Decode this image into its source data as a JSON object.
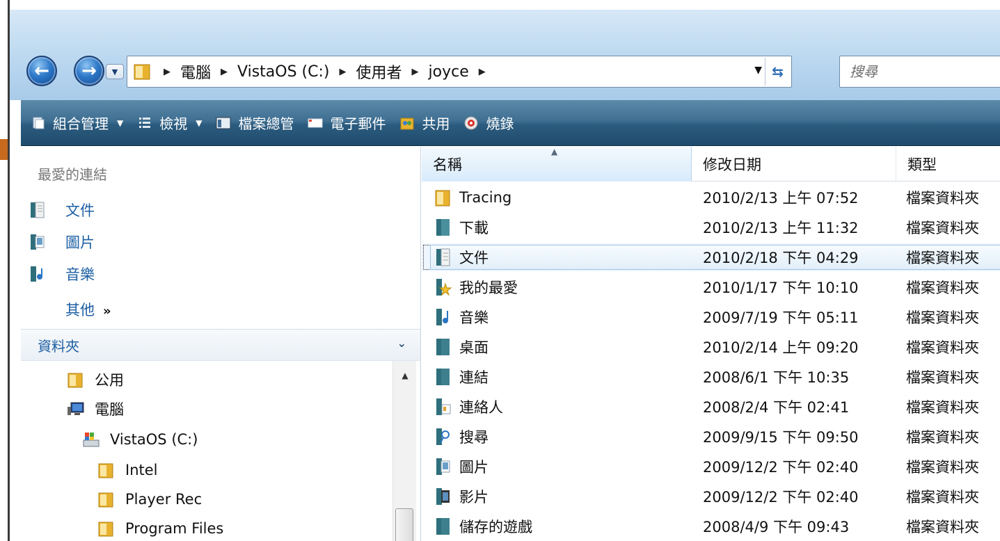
{
  "address": {
    "crumbs": [
      "電腦",
      "VistaOS (C:)",
      "使用者",
      "joyce"
    ],
    "search_placeholder": "搜尋"
  },
  "toolbar": {
    "organize": "組合管理",
    "views": "檢視",
    "explore": "檔案總管",
    "email": "電子郵件",
    "share": "共用",
    "burn": "燒錄"
  },
  "navpane": {
    "favorites_title": "最愛的連結",
    "favorites": [
      {
        "label": "文件",
        "icon": "documents-icon"
      },
      {
        "label": "圖片",
        "icon": "pictures-icon"
      },
      {
        "label": "音樂",
        "icon": "music-icon"
      }
    ],
    "more_label": "其他",
    "more_arrow": "»",
    "folders_title": "資料夾",
    "tree": [
      {
        "label": "公用",
        "icon": "folder-icon"
      },
      {
        "label": "電腦",
        "icon": "computer-icon"
      },
      {
        "label": "VistaOS (C:)",
        "icon": "drive-icon"
      },
      {
        "label": "Intel",
        "icon": "folder-icon"
      },
      {
        "label": "Player Rec",
        "icon": "folder-icon"
      },
      {
        "label": "Program Files",
        "icon": "folder-icon"
      }
    ]
  },
  "list": {
    "columns": {
      "name": "名稱",
      "date": "修改日期",
      "type": "類型"
    },
    "rows": [
      {
        "name": "Tracing",
        "date": "2010/2/13 上午 07:52",
        "type": "檔案資料夾",
        "icon": "folder-icon"
      },
      {
        "name": "下載",
        "date": "2010/2/13 上午 11:32",
        "type": "檔案資料夾",
        "icon": "downloads-icon"
      },
      {
        "name": "文件",
        "date": "2010/2/18 下午 04:29",
        "type": "檔案資料夾",
        "icon": "documents-icon"
      },
      {
        "name": "我的最愛",
        "date": "2010/1/17 下午 10:10",
        "type": "檔案資料夾",
        "icon": "favorites-icon"
      },
      {
        "name": "音樂",
        "date": "2009/7/19 下午 05:11",
        "type": "檔案資料夾",
        "icon": "music-icon"
      },
      {
        "name": "桌面",
        "date": "2010/2/14 上午 09:20",
        "type": "檔案資料夾",
        "icon": "desktop-icon"
      },
      {
        "name": "連結",
        "date": "2008/6/1 下午 10:35",
        "type": "檔案資料夾",
        "icon": "links-icon"
      },
      {
        "name": "連絡人",
        "date": "2008/2/4 下午 02:41",
        "type": "檔案資料夾",
        "icon": "contacts-icon"
      },
      {
        "name": "搜尋",
        "date": "2009/9/15 下午 09:50",
        "type": "檔案資料夾",
        "icon": "searches-icon"
      },
      {
        "name": "圖片",
        "date": "2009/12/2 下午 02:40",
        "type": "檔案資料夾",
        "icon": "pictures-icon"
      },
      {
        "name": "影片",
        "date": "2009/12/2 下午 02:40",
        "type": "檔案資料夾",
        "icon": "videos-icon"
      },
      {
        "name": "儲存的遊戲",
        "date": "2008/4/9 下午 09:43",
        "type": "檔案資料夾",
        "icon": "saved-games-icon"
      }
    ]
  }
}
